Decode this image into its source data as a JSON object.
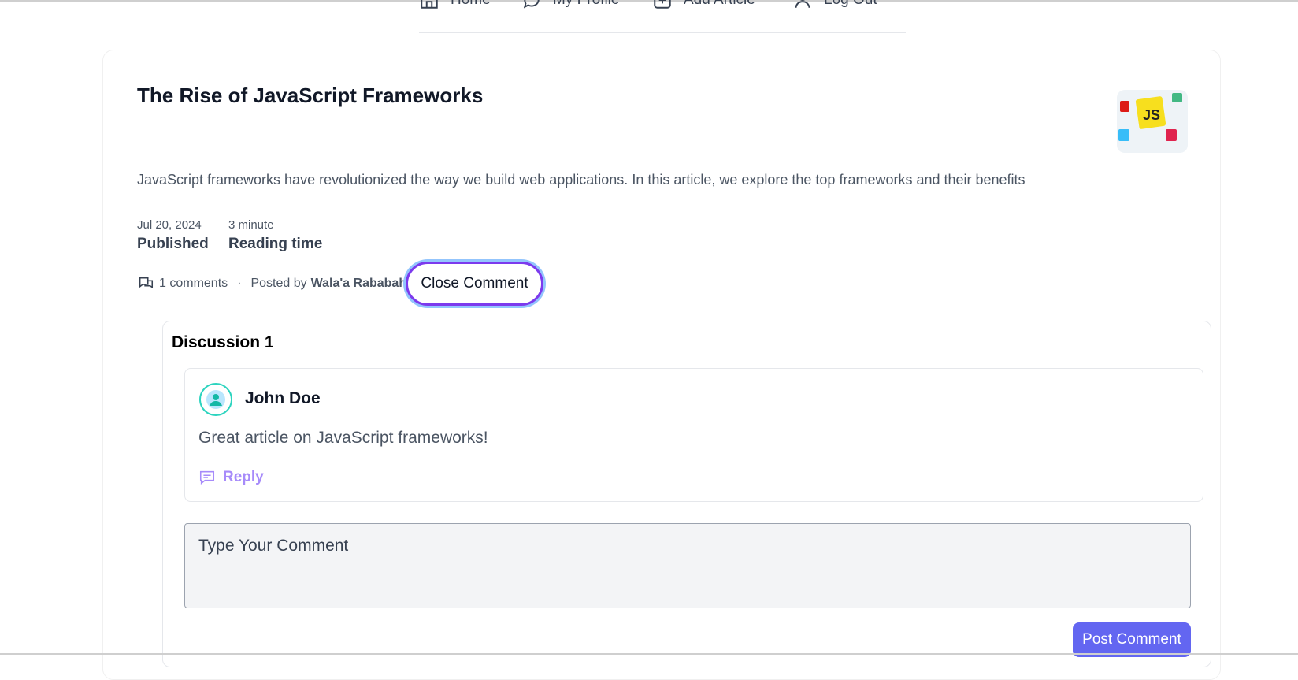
{
  "nav": {
    "items": [
      {
        "label": "Home",
        "icon": "home-icon"
      },
      {
        "label": "My Profile",
        "icon": "chat-bubble-icon"
      },
      {
        "label": "Add Article",
        "icon": "plus-square-icon"
      },
      {
        "label": "Log Out",
        "icon": "user-icon"
      }
    ]
  },
  "article": {
    "title": "The Rise of JavaScript Frameworks",
    "excerpt": "JavaScript frameworks have revolutionized the way we build web applications. In this article, we explore the top frameworks and their benefits",
    "published_date": "Jul 20, 2024",
    "published_label": "Published",
    "reading_value": "3 minute",
    "reading_label": "Reading time",
    "comments_count": "1 comments",
    "separator": "·",
    "posted_by_label": "Posted by",
    "author": "Wala'a Rababah",
    "thumbnail_text": "JS",
    "close_comment_label": "Close Comment"
  },
  "discussion": {
    "title": "Discussion 1",
    "comments": [
      {
        "author": "John Doe",
        "text": "Great article on JavaScript frameworks!",
        "reply_label": "Reply"
      }
    ],
    "input_placeholder": "Type Your Comment",
    "post_label": "Post Comment"
  },
  "colors": {
    "accent": "#6366f1",
    "reply": "#a78bfa",
    "avatar_ring": "#2dd4bf",
    "js_yellow": "#f7df1e"
  }
}
